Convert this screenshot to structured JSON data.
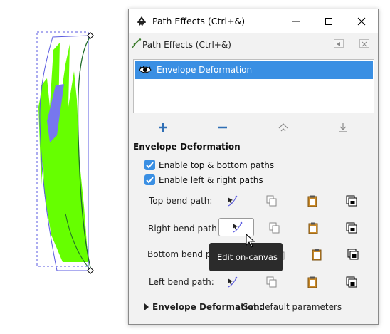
{
  "window": {
    "title": "Path Effects (Ctrl+&)",
    "panel_title": "Path Effects (Ctrl+&)"
  },
  "effects_list": {
    "items": [
      {
        "label": "Envelope Deformation",
        "visible": true,
        "selected": true
      }
    ],
    "buttons": {
      "add": "plus-icon",
      "remove": "minus-icon",
      "move_up": "arrow-up-icon",
      "move_down": "arrow-down-icon"
    }
  },
  "effect_params": {
    "heading": "Envelope Deformation",
    "checkboxes": [
      {
        "label": "Enable top & bottom paths",
        "checked": true
      },
      {
        "label": "Enable left & right paths",
        "checked": true
      }
    ],
    "bend_paths": [
      {
        "label": "Top bend path:"
      },
      {
        "label": "Right bend path:"
      },
      {
        "label": "Bottom bend path:"
      },
      {
        "label": "Left bend path:"
      }
    ],
    "tooltip": "Edit on-canvas"
  },
  "footer": {
    "bold": "Envelope Deformation:",
    "text": " Set default parameters"
  },
  "colors": {
    "selection": "#3a8fe3",
    "shape_fill": "#66ff00",
    "shape_accent": "#7777ee",
    "path_stroke": "#1f6b2a",
    "envelope": "#5a5ae0"
  }
}
